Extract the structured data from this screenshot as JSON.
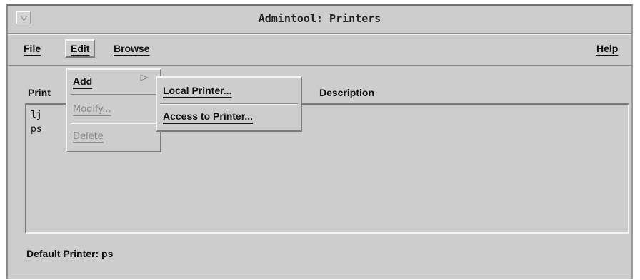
{
  "window": {
    "title": "Admintool: Printers",
    "window_menu_icon": "triangle-down-icon"
  },
  "menubar": {
    "items": [
      {
        "label": "File"
      },
      {
        "label": "Edit"
      },
      {
        "label": "Browse"
      },
      {
        "label": "Help"
      }
    ],
    "active": "Edit"
  },
  "columns": {
    "printer": "Print",
    "description": "Description"
  },
  "printers": [
    {
      "name": "lj"
    },
    {
      "name": "ps"
    }
  ],
  "footer": {
    "default_printer": "Default Printer: ps"
  },
  "edit_menu": {
    "items": [
      {
        "label": "Add",
        "enabled": true,
        "cascade_icon": "cascade-arrow-icon"
      },
      {
        "label": "Modify...",
        "enabled": false
      },
      {
        "label": "Delete",
        "enabled": false
      }
    ]
  },
  "add_submenu": {
    "items": [
      {
        "label": "Local Printer..."
      },
      {
        "label": "Access to Printer..."
      }
    ]
  }
}
